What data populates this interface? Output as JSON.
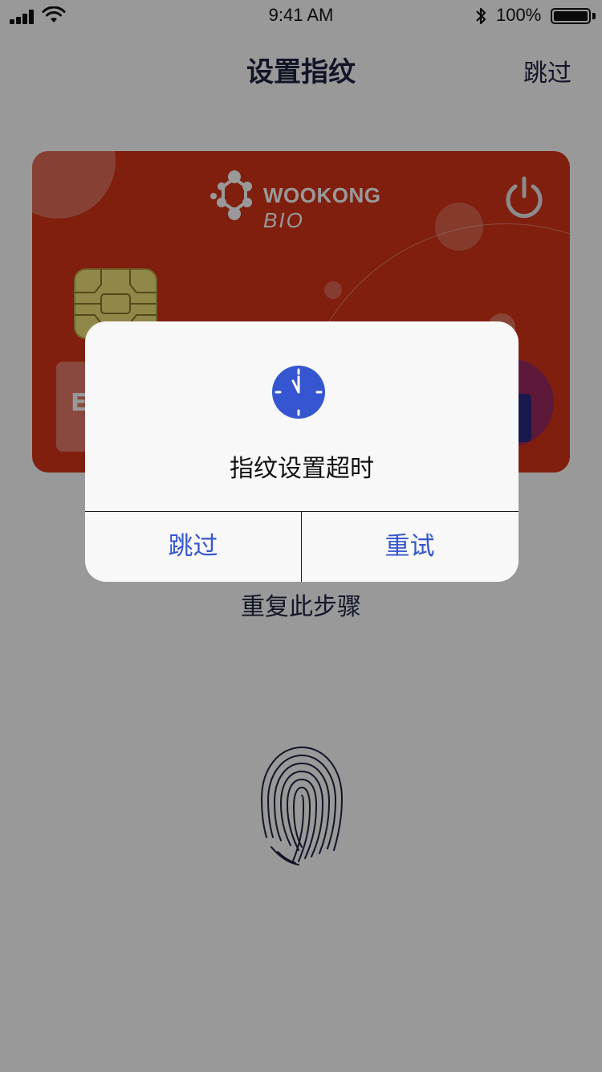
{
  "status_bar": {
    "time": "9:41 AM",
    "battery": "100%"
  },
  "nav": {
    "title": "设置指纹",
    "skip": "跳过"
  },
  "card": {
    "brand": "WOOKONG",
    "brand_suffix": "BIO",
    "label_partial": "E"
  },
  "body": {
    "repeat_step": "重复此步骤"
  },
  "alert": {
    "icon": "clock-icon",
    "message": "指纹设置超时",
    "buttons": {
      "skip": "跳过",
      "retry": "重试"
    }
  },
  "colors": {
    "accent": "#3556d0",
    "card": "#d63518",
    "nav_text": "#1d2340"
  }
}
